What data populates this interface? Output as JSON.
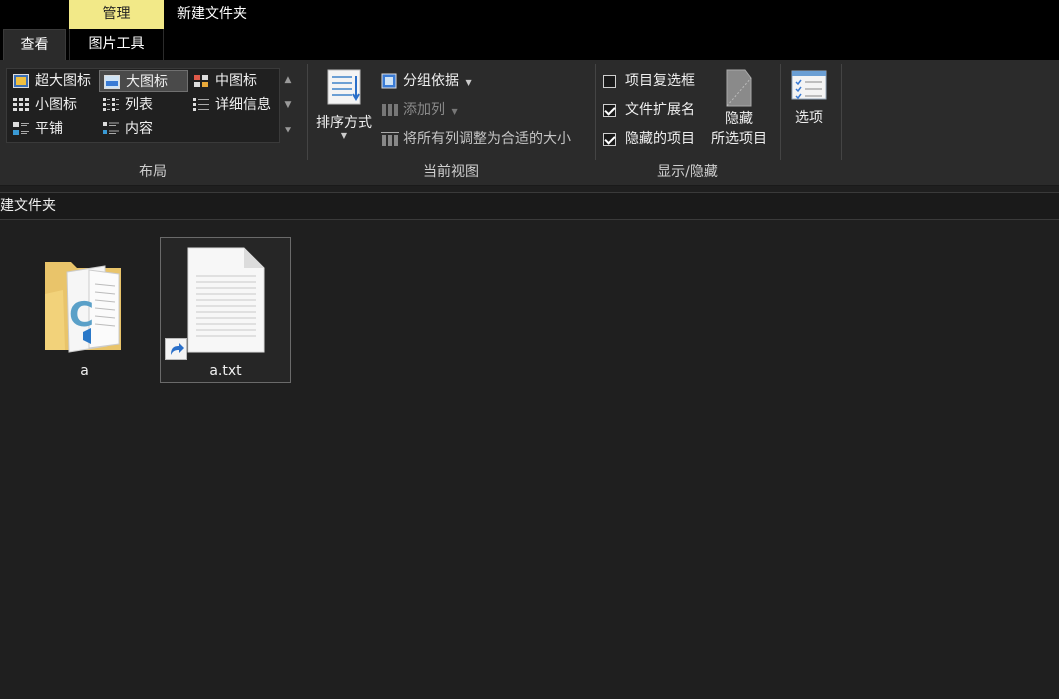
{
  "titlebar": {
    "context_tab": "管理",
    "window_title": "新建文件夹"
  },
  "tabs": [
    {
      "label": "查看",
      "active": true
    },
    {
      "label": "图片工具",
      "active": false
    }
  ],
  "ribbon": {
    "layout": {
      "label": "布局",
      "items": [
        {
          "label": "超大图标",
          "selected": false
        },
        {
          "label": "大图标",
          "selected": true
        },
        {
          "label": "中图标",
          "selected": false
        },
        {
          "label": "小图标",
          "selected": false
        },
        {
          "label": "列表",
          "selected": false
        },
        {
          "label": "详细信息",
          "selected": false
        },
        {
          "label": "平铺",
          "selected": false
        },
        {
          "label": "内容",
          "selected": false
        }
      ]
    },
    "current_view": {
      "label": "当前视图",
      "sort_by": "排序方式",
      "group_by": "分组依据",
      "add_column": "添加列",
      "fit_columns": "将所有列调整为合适的大小"
    },
    "show_hide": {
      "label": "显示/隐藏",
      "checkboxes": [
        {
          "label": "项目复选框",
          "checked": false
        },
        {
          "label": "文件扩展名",
          "checked": true
        },
        {
          "label": "隐藏的项目",
          "checked": true
        }
      ],
      "hide_selected_line1": "隐藏",
      "hide_selected_line2": "所选项目"
    },
    "options": {
      "label": "选项"
    }
  },
  "address": {
    "crumb": "建文件夹"
  },
  "files": [
    {
      "name": "a",
      "type": "folder",
      "selected": false
    },
    {
      "name": "a.txt",
      "type": "text-shortcut",
      "selected": true
    }
  ],
  "colors": {
    "context_tab": "#f2e988",
    "background": "#1f1f1f",
    "ribbon": "#2b2b2b"
  }
}
